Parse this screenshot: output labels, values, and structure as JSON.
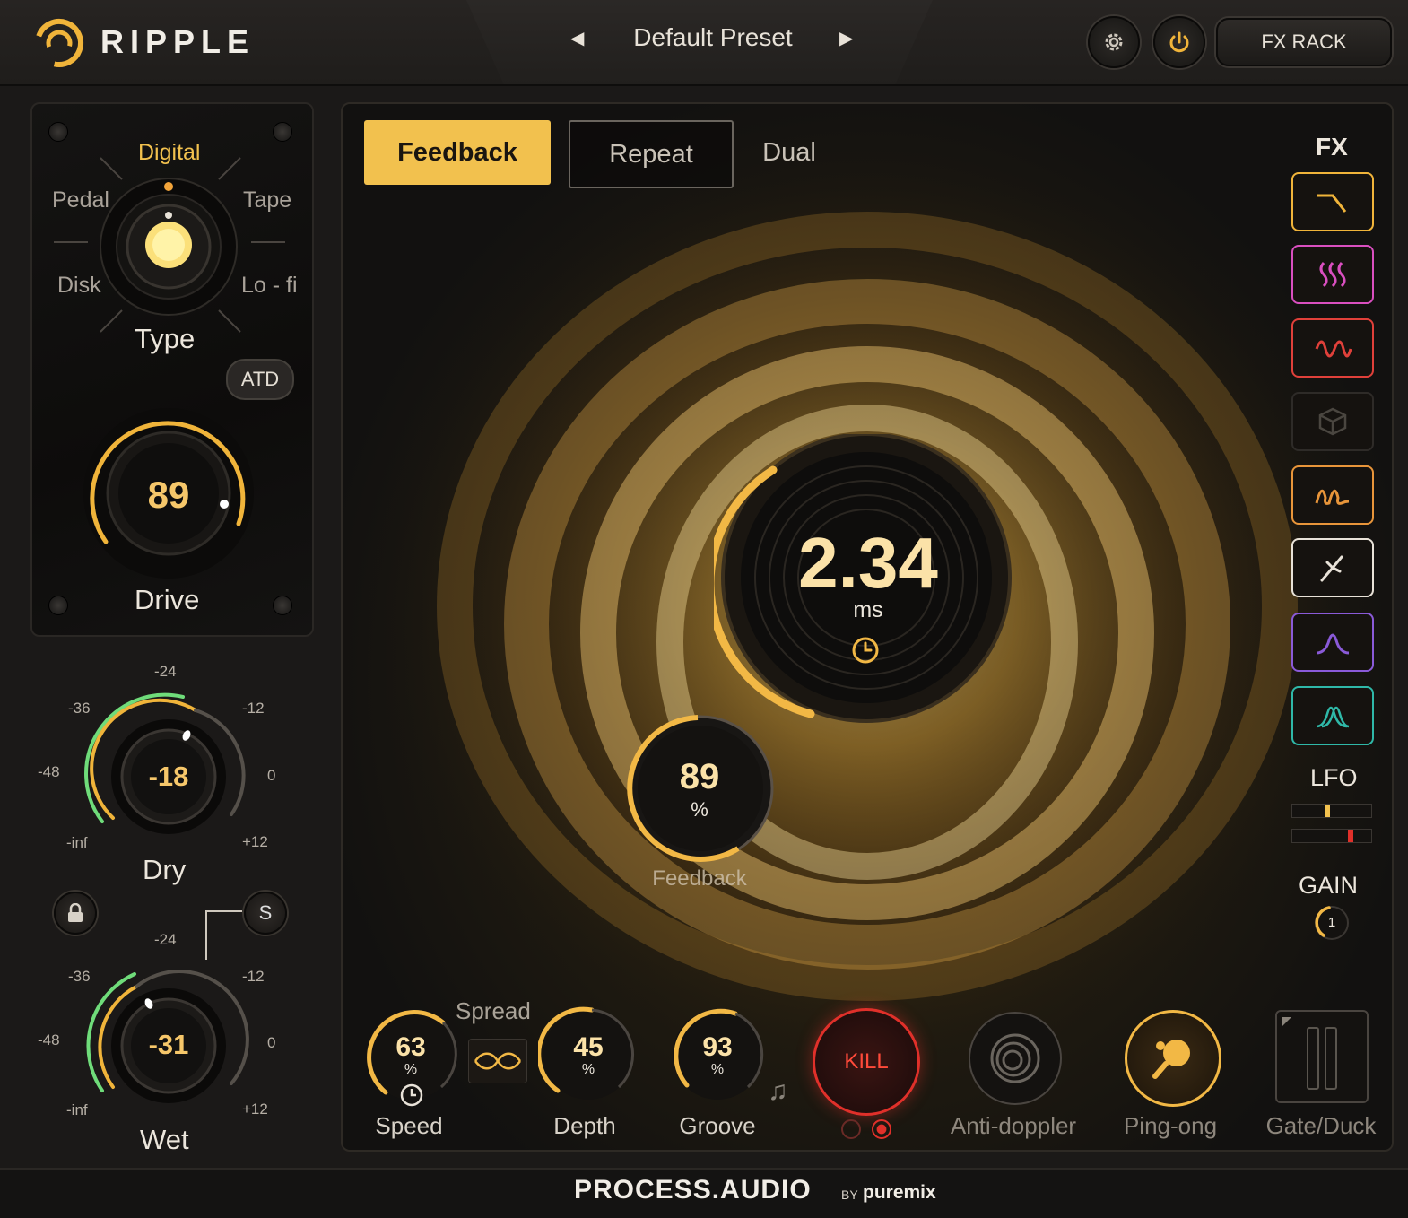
{
  "app": {
    "name": "RIPPLE"
  },
  "header": {
    "preset_name": "Default Preset",
    "fx_rack_label": "FX RACK"
  },
  "type_selector": {
    "options": {
      "digital": "Digital",
      "pedal": "Pedal",
      "tape": "Tape",
      "disk": "Disk",
      "lofi": "Lo - fi"
    },
    "selected": "Digital",
    "label": "Type",
    "atd_label": "ATD"
  },
  "drive": {
    "value": "89",
    "label": "Drive"
  },
  "dry": {
    "value": "-18",
    "label": "Dry",
    "scale": {
      "m24": "-24",
      "m36": "-36",
      "m12": "-12",
      "m48": "-48",
      "zero": "0",
      "inf": "-inf",
      "p12": "+12"
    }
  },
  "wet": {
    "value": "-31",
    "label": "Wet",
    "solo_label": "S",
    "scale": {
      "m24": "-24",
      "m36": "-36",
      "m12": "-12",
      "m48": "-48",
      "zero": "0",
      "inf": "-inf",
      "p12": "+12"
    }
  },
  "tabs": [
    "Feedback",
    "Repeat",
    "Dual"
  ],
  "active_tab": "Feedback",
  "center": {
    "time_value": "2.34",
    "time_unit": "ms"
  },
  "feedback": {
    "value": "89",
    "unit": "%",
    "label": "Feedback"
  },
  "fx_panel": {
    "title": "FX",
    "lfo_label": "LFO",
    "gain_label": "GAIN",
    "gain_value": "1",
    "buttons": [
      {
        "icon": "lowpass-filter-icon",
        "color": "#f0b43a"
      },
      {
        "icon": "heat-waves-icon",
        "color": "#d94fc0"
      },
      {
        "icon": "distortion-wave-icon",
        "color": "#e0403a"
      },
      {
        "icon": "cube-icon",
        "color": "#3a3733"
      },
      {
        "icon": "loop-wave-icon",
        "color": "#e8953a"
      },
      {
        "icon": "tuning-fork-icon",
        "color": "#e8e2d8"
      },
      {
        "icon": "bell-curve-icon",
        "color": "#8a5ad8"
      },
      {
        "icon": "double-bell-icon",
        "color": "#2fb8a8"
      }
    ]
  },
  "bottom": {
    "spread_label": "Spread",
    "speed": {
      "value": "63",
      "unit": "%",
      "label": "Speed"
    },
    "depth": {
      "value": "45",
      "unit": "%",
      "label": "Depth"
    },
    "groove": {
      "value": "93",
      "unit": "%",
      "label": "Groove"
    },
    "kill_label": "KILL",
    "anti_doppler_label": "Anti-doppler",
    "ping_pong_label": "Ping-ong",
    "gate_duck_label": "Gate/Duck"
  },
  "footer": {
    "brand": "PROCESS.AUDIO",
    "by": "BY",
    "partner": "puremix"
  },
  "colors": {
    "accent": "#f2c14e",
    "green": "#6fdc7a",
    "kill": "#e0302a"
  }
}
